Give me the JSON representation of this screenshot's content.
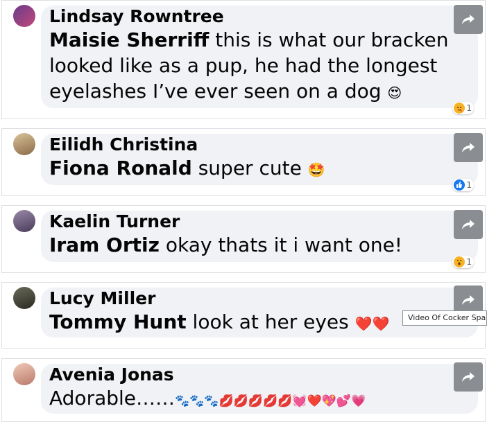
{
  "comments": [
    {
      "author": "Lindsay Rowntree",
      "mention": "Maisie Sherriff",
      "text": " this is what our bracken looked like as a pup, he had the longest eyelashes I’ve ever seen on a dog ",
      "emoji": "😍",
      "reaction": {
        "icon": "care-icon",
        "count": "1"
      }
    },
    {
      "author": "Eilidh Christina",
      "mention": "Fiona Ronald",
      "text": " super cute ",
      "emoji": "🤩",
      "reaction": {
        "icon": "like-icon",
        "count": "1"
      }
    },
    {
      "author": "Kaelin Turner",
      "mention": "Iram Ortiz",
      "text": " okay thats it i want one!",
      "emoji": "",
      "reaction": {
        "icon": "wow-icon",
        "count": "1"
      }
    },
    {
      "author": "Lucy Miller",
      "mention": "Tommy Hunt",
      "text": " look at her eyes ",
      "emoji": "❤️❤️",
      "reaction": null
    },
    {
      "author": "Avenia Jonas",
      "mention": "",
      "text": "Adorable……",
      "emoji": "🐾🐾🐾💋💋💋💋💋💓❤️💖💕💗",
      "reaction": null
    }
  ],
  "tooltip": "Video Of Cocker Spaniel",
  "colors": {
    "bubble": "#f0f2f5",
    "share_button": "#8a8d91",
    "like_blue": "#1877f2",
    "border": "#dddfe2"
  }
}
